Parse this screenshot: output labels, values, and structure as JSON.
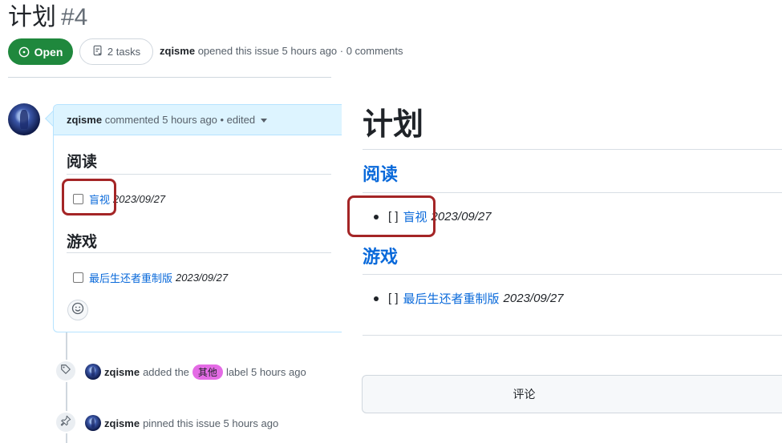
{
  "issue": {
    "title": "计划",
    "number": "#4",
    "state": "Open",
    "tasks": "2 tasks",
    "author": "zqisme",
    "opened_text": "opened this issue 5 hours ago · 0 comments"
  },
  "comment": {
    "author": "zqisme",
    "meta": "commented 5 hours ago • edited",
    "sections": [
      {
        "heading": "阅读",
        "task_link": "盲视",
        "task_date": "2023/09/27"
      },
      {
        "heading": "游戏",
        "task_link": "最后生还者重制版",
        "task_date": "2023/09/27"
      }
    ]
  },
  "timeline": {
    "label_event": {
      "actor": "zqisme",
      "before": "added the",
      "label": "其他",
      "after": "label 5 hours ago",
      "label_color": "#e46be5"
    },
    "pin_event": {
      "actor": "zqisme",
      "text": "pinned this issue 5 hours ago"
    }
  },
  "preview": {
    "h1": "计划",
    "sections": [
      {
        "heading": "阅读",
        "checkbox": "[ ]",
        "link": "盲视",
        "date": "2023/09/27"
      },
      {
        "heading": "游戏",
        "checkbox": "[ ]",
        "link": "最后生还者重制版",
        "date": "2023/09/27"
      }
    ],
    "comment_button": "评论"
  },
  "colors": {
    "open_green": "#1f883d",
    "link_blue": "#0969da",
    "highlight_red": "#a42526",
    "comment_header_bg": "#ddf4ff"
  }
}
